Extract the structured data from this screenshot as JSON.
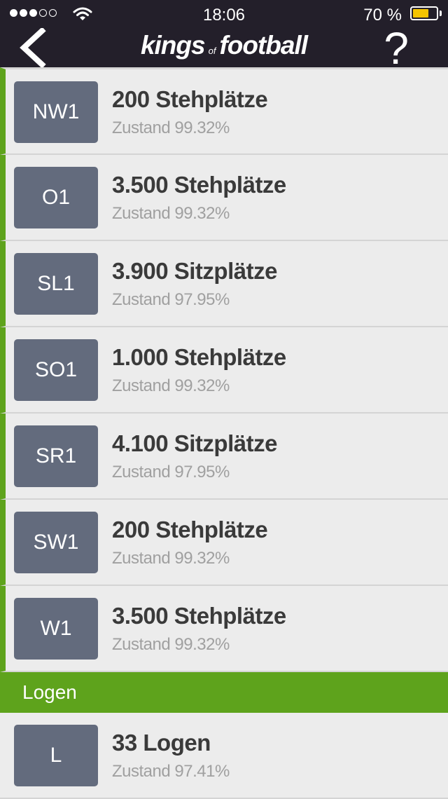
{
  "status_bar": {
    "time": "18:06",
    "battery_percent": "70 %",
    "battery_level": 0.7,
    "signal_dots_filled": 3,
    "signal_dots_total": 5
  },
  "nav": {
    "logo_kings": "kings",
    "logo_of": "of",
    "logo_football": "football",
    "help_label": "?"
  },
  "colors": {
    "accent_green": "#5ea31c",
    "nav_bg": "#231f2a",
    "badge_bg": "#636b7d"
  },
  "sectors": [
    {
      "code": "NW1",
      "title": "200 Stehplätze",
      "condition": "Zustand 99.32%"
    },
    {
      "code": "O1",
      "title": "3.500 Stehplätze",
      "condition": "Zustand 99.32%"
    },
    {
      "code": "SL1",
      "title": "3.900 Sitzplätze",
      "condition": "Zustand 97.95%"
    },
    {
      "code": "SO1",
      "title": "1.000 Stehplätze",
      "condition": "Zustand 99.32%"
    },
    {
      "code": "SR1",
      "title": "4.100 Sitzplätze",
      "condition": "Zustand 97.95%"
    },
    {
      "code": "SW1",
      "title": "200 Stehplätze",
      "condition": "Zustand 99.32%"
    },
    {
      "code": "W1",
      "title": "3.500 Stehplätze",
      "condition": "Zustand 99.32%"
    }
  ],
  "logen_section": {
    "header": "Logen",
    "items": [
      {
        "code": "L",
        "title": "33 Logen",
        "condition": "Zustand 97.41%"
      }
    ]
  }
}
